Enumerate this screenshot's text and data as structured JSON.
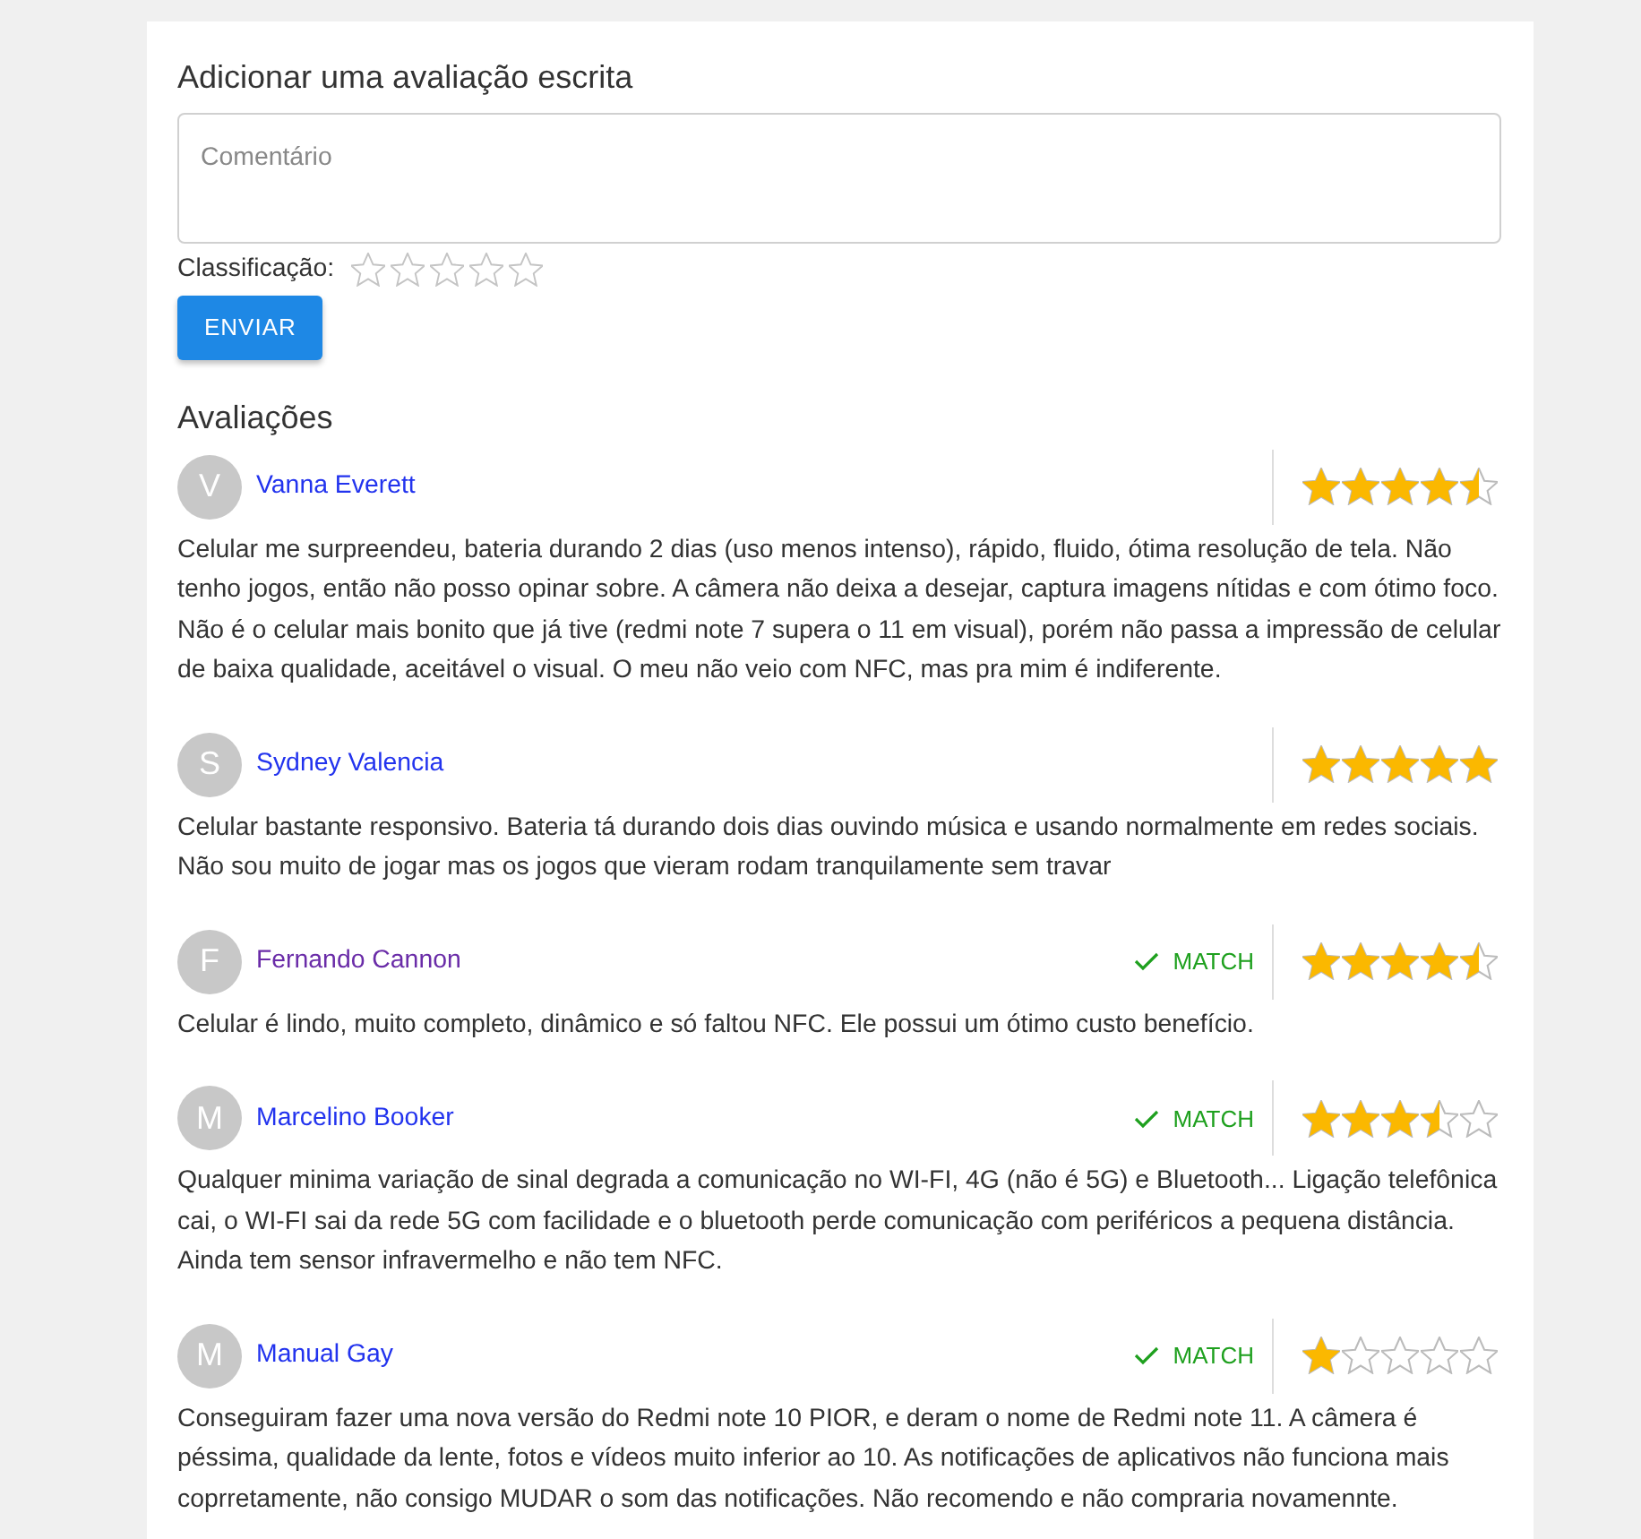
{
  "form": {
    "title": "Adicionar uma avaliação escrita",
    "comment": {
      "placeholder": "Comentário"
    },
    "rating_label": "Classificação:",
    "stars": 0,
    "submit": "ENVIAR"
  },
  "reviews_title": "Avaliações",
  "reviews": [
    {
      "initial": "V",
      "name": "Vanna Everett",
      "visited": false,
      "stars": 4.5,
      "text": "Celular me surpreendeu, bateria durando 2 dias (uso menos intenso), rápido, fluido, ótima resolução de tela. Não tenho jogos, então não posso opinar sobre. A câmera não deixa a desejar, captura imagens nítidas e com ótimo foco. Não é o celular mais bonito que já tive (redmi note 7 supera o 11 em visual), porém não passa a impressão de celular de baixa qualidade, aceitável o visual. O meu não veio com NFC, mas pra mim é indiferente."
    },
    {
      "initial": "S",
      "name": "Sydney Valencia",
      "visited": false,
      "stars": 5,
      "text": "Celular bastante responsivo. Bateria tá durando dois dias ouvindo música e usando normalmente em redes sociais. Não sou muito de jogar mas os jogos que vieram rodam tranquilamente sem travar"
    },
    {
      "initial": "F",
      "name": "Fernando Cannon",
      "visited": true,
      "match_label": "MATCH",
      "stars": 4.5,
      "text": "Celular é lindo, muito completo, dinâmico e só faltou NFC. Ele possui um ótimo custo benefício."
    },
    {
      "initial": "M",
      "name": "Marcelino Booker",
      "visited": false,
      "match_label": "MATCH",
      "stars": 3.5,
      "text": "Qualquer minima variação de sinal degrada a comunicação no WI-FI, 4G (não é 5G) e Bluetooth... Ligação telefônica cai, o WI-FI sai da rede 5G com facilidade e o bluetooth perde comunicação com periféricos a pequena distância. Ainda tem sensor infravermelho e não tem NFC."
    },
    {
      "initial": "M",
      "name": "Manual Gay",
      "visited": false,
      "match_label": "MATCH",
      "stars": 1,
      "text": "Conseguiram fazer uma nova versão do Redmi note 10 PIOR, e deram o nome de Redmi note 11. A câmera é péssima, qualidade da lente, fotos e vídeos muito inferior ao 10. As notificações de aplicativos não funciona mais coprretamente, não consigo MUDAR o som das notificações. Não recomendo e não compraria novamennte."
    }
  ]
}
